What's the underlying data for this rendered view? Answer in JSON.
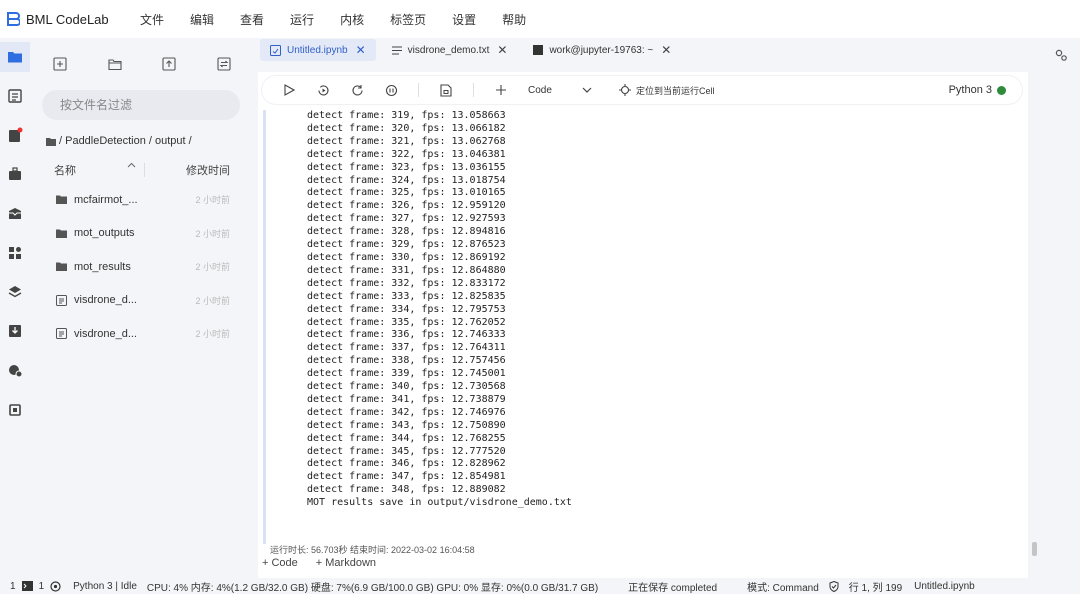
{
  "app": {
    "title": "BML CodeLab"
  },
  "menu": [
    "文件",
    "编辑",
    "查看",
    "运行",
    "内核",
    "标签页",
    "设置",
    "帮助"
  ],
  "rail_icons": [
    "folder-icon",
    "list-icon",
    "notebook-badge-icon",
    "briefcase-icon",
    "inbox-icon",
    "grid-icon",
    "layers-icon",
    "download-icon",
    "gear-cloud-icon",
    "chip-icon"
  ],
  "file_browser": {
    "toolbar": [
      "new-file-icon",
      "new-folder-icon",
      "upload-icon",
      "refresh-icon"
    ],
    "filter_placeholder": "按文件名过滤",
    "breadcrumb": "/ PaddleDetection / output /",
    "columns": {
      "name": "名称",
      "modified": "修改时间"
    },
    "files": [
      {
        "name": "mcfairmot_...",
        "time": "2 小时前",
        "type": "folder"
      },
      {
        "name": "mot_outputs",
        "time": "2 小时前",
        "type": "folder"
      },
      {
        "name": "mot_results",
        "time": "2 小时前",
        "type": "folder"
      },
      {
        "name": "visdrone_d...",
        "time": "2 小时前",
        "type": "file"
      },
      {
        "name": "visdrone_d...",
        "time": "2 小时前",
        "type": "file"
      }
    ]
  },
  "tabs": [
    {
      "label": "Untitled.ipynb",
      "active": true,
      "icon": "notebook-icon"
    },
    {
      "label": "visdrone_demo.txt",
      "active": false,
      "icon": "text-file-icon"
    },
    {
      "label": "work@jupyter-19763: ~",
      "active": false,
      "icon": "terminal-icon"
    }
  ],
  "notebook_toolbar": {
    "cell_type": "Code",
    "locate_label": "定位到当前运行Cell",
    "kernel": "Python 3",
    "kernel_status_color": "#2e8b3a"
  },
  "output_lines": [
    "detect frame: 319, fps: 13.058663",
    "detect frame: 320, fps: 13.066182",
    "detect frame: 321, fps: 13.062768",
    "detect frame: 322, fps: 13.046381",
    "detect frame: 323, fps: 13.036155",
    "detect frame: 324, fps: 13.018754",
    "detect frame: 325, fps: 13.010165",
    "detect frame: 326, fps: 12.959120",
    "detect frame: 327, fps: 12.927593",
    "detect frame: 328, fps: 12.894816",
    "detect frame: 329, fps: 12.876523",
    "detect frame: 330, fps: 12.869192",
    "detect frame: 331, fps: 12.864880",
    "detect frame: 332, fps: 12.833172",
    "detect frame: 333, fps: 12.825835",
    "detect frame: 334, fps: 12.795753",
    "detect frame: 335, fps: 12.762052",
    "detect frame: 336, fps: 12.746333",
    "detect frame: 337, fps: 12.764311",
    "detect frame: 338, fps: 12.757456",
    "detect frame: 339, fps: 12.745001",
    "detect frame: 340, fps: 12.730568",
    "detect frame: 341, fps: 12.738879",
    "detect frame: 342, fps: 12.746976",
    "detect frame: 343, fps: 12.750890",
    "detect frame: 344, fps: 12.768255",
    "detect frame: 345, fps: 12.777520",
    "detect frame: 346, fps: 12.828962",
    "detect frame: 347, fps: 12.854981",
    "detect frame: 348, fps: 12.889082",
    "MOT results save in output/visdrone_demo.txt"
  ],
  "run_info": "运行时长: 56.703秒    结束时间: 2022-03-02 16:04:58",
  "add_cells": {
    "code": "+ Code",
    "markdown": "+ Markdown"
  },
  "status": {
    "num1": "1",
    "num2": "1",
    "kernel": "Python 3 | Idle",
    "resources": "CPU:  4% 内存:  4%(1.2 GB/32.0 GB) 硬盘:  7%(6.9 GB/100.0 GB)  GPU:  0%  显存:  0%(0.0 GB/31.7 GB)",
    "saving": "正在保存 completed",
    "mode": "模式:  Command",
    "position": "行 1, 列 199",
    "file": "Untitled.ipynb"
  }
}
